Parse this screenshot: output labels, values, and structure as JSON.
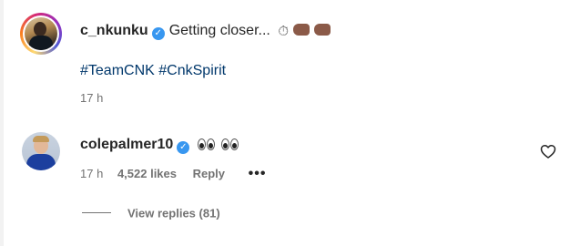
{
  "caption": {
    "username": "c_nkunku",
    "text": "Getting closer...",
    "emojis": [
      "stopwatch-emoji",
      "left-fist-emoji",
      "right-fist-emoji"
    ],
    "hashtags": [
      "#TeamCNK",
      "#CnkSpirit"
    ],
    "time": "17 h"
  },
  "comment": {
    "username": "colepalmer10",
    "emojis": [
      "eyes-emoji",
      "eyes-emoji"
    ],
    "time": "17 h",
    "likes": "4,522 likes",
    "reply_label": "Reply",
    "more_label": "•••"
  },
  "view_replies": {
    "label": "View replies (81)"
  },
  "colors": {
    "verified": "#3897f0",
    "hashtag": "#00376b",
    "muted": "#737373",
    "text": "#262626"
  }
}
